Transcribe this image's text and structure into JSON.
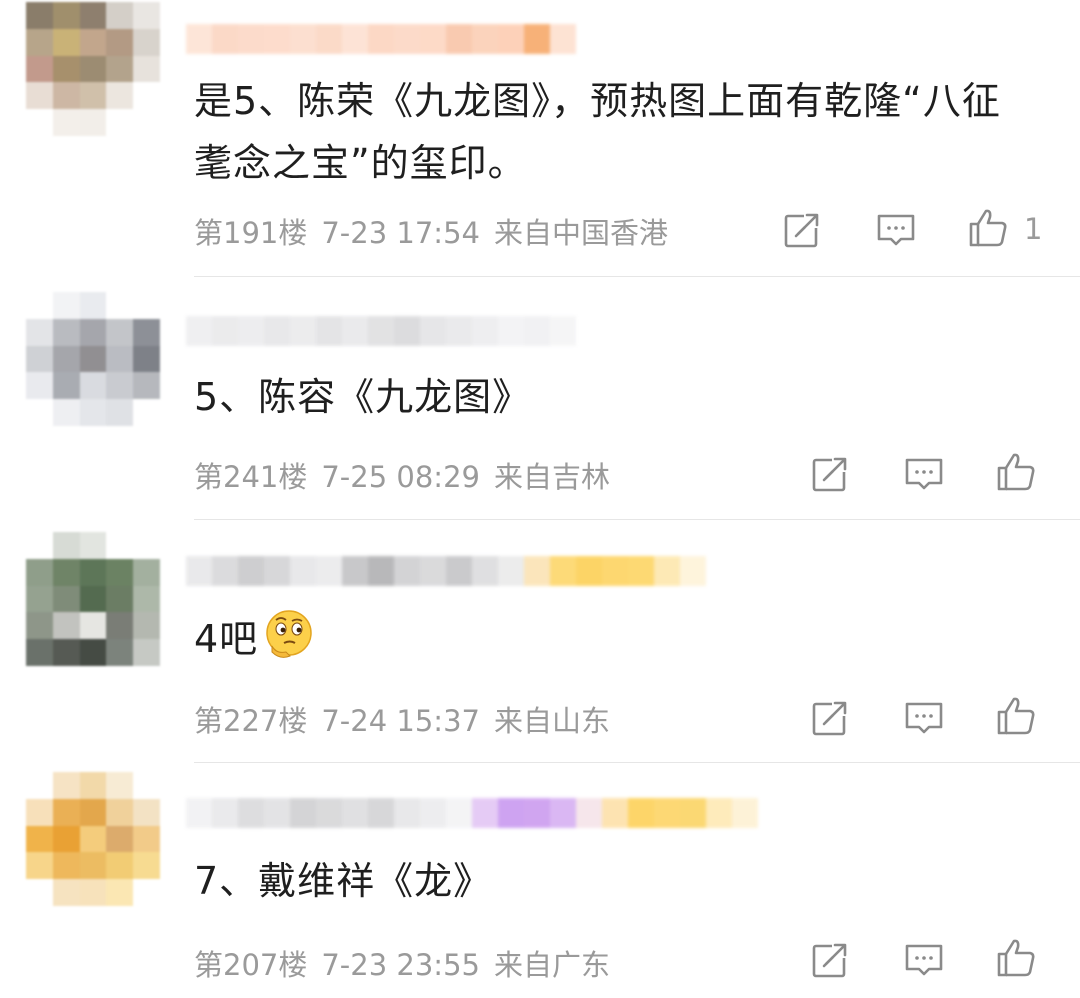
{
  "comments": [
    {
      "text": "是5、陈荣《九龙图》，预热图上面有乾隆“八征耄念之宝”的玺印。",
      "floor": "第191楼",
      "date": "7-23 17:54",
      "location": "来自中国香港",
      "like_count": "1",
      "avatar_colors": [
        "#8a7d6a",
        "#a08f6c",
        "#8e7f6e",
        "#d4cfc8",
        "#e9e6e2",
        "#b7a58a",
        "#c9b277",
        "#c2a68c",
        "#b39a84",
        "#d8d3cc",
        "#c29a8c",
        "#a7906c",
        "#9c8c72",
        "#b3a38c",
        "#e7e2dc",
        "#e8ddd4",
        "#cdb7a4",
        "#d0c0aa",
        "#ece6df",
        "#ffffff",
        "#ffffff",
        "#f3efea",
        "#f2eee9",
        "#ffffff",
        "#ffffff"
      ],
      "username_colors": [
        "#fde3d4",
        "#fbd5c2",
        "#fcd8c6",
        "#fdd9c7",
        "#fcdccb",
        "#fbd7c3",
        "#fde1d2",
        "#fcd4bf",
        "#fcd7c4",
        "#fdd6c2",
        "#f9c5a8",
        "#fbcfb5",
        "#fdcdb2",
        "#f7a96a",
        "#fde0cf"
      ]
    },
    {
      "text": "5、陈容《九龙图》",
      "floor": "第241楼",
      "date": "7-25 08:29",
      "location": "来自吉林",
      "like_count": "",
      "avatar_colors": [
        "#ffffff",
        "#f2f3f5",
        "#e9ebef",
        "#ffffff",
        "#ffffff",
        "#e3e4e7",
        "#b9bbc0",
        "#a5a6ac",
        "#c3c5c9",
        "#8d9097",
        "#cfd1d5",
        "#a5a6ab",
        "#918f92",
        "#babcc2",
        "#7e8188",
        "#e9eaee",
        "#a9acb2",
        "#d9dbe0",
        "#c9cbd0",
        "#b6b8bd",
        "#ffffff",
        "#eeeff2",
        "#e4e6ea",
        "#dfe1e5",
        "#ffffff"
      ],
      "username_colors": [
        "#eeeef0",
        "#e9e9eb",
        "#ececee",
        "#e6e6e8",
        "#eaeaec",
        "#e2e2e4",
        "#e8e8ea",
        "#dfdfe1",
        "#d9d9db",
        "#e4e4e6",
        "#e8e8ea",
        "#ededef",
        "#f2f2f4",
        "#f0f0f2",
        "#f5f5f6",
        "#ffffff"
      ]
    },
    {
      "text": "4吧",
      "floor": "第227楼",
      "date": "7-24 15:37",
      "location": "来自山东",
      "like_count": "",
      "avatar_colors": [
        "#ffffff",
        "#d7dbd5",
        "#e2e5e0",
        "#ffffff",
        "#ffffff",
        "#8f9e8a",
        "#6f8467",
        "#5d7658",
        "#6b8263",
        "#a3b09f",
        "#95a290",
        "#7f8c79",
        "#546b50",
        "#6b7d64",
        "#adb8a9",
        "#8e9689",
        "#c2c3bf",
        "#e6e6e2",
        "#7a7d76",
        "#b4b8b0",
        "#6a716a",
        "#565a54",
        "#454b44",
        "#7c837c",
        "#c6c9c4"
      ],
      "username_colors": [
        "#e7e7e9",
        "#d8d8da",
        "#c9c9cb",
        "#d3d3d5",
        "#e6e6e8",
        "#eaeaec",
        "#c3c3c5",
        "#b1b1b3",
        "#cfcfd1",
        "#d6d6d8",
        "#c5c5c7",
        "#dcdcde",
        "#eaeaea",
        "#fbe3b4",
        "#fdd66a",
        "#fcd056",
        "#fdd361",
        "#fdd564",
        "#fde7ad",
        "#fef3d9"
      ]
    },
    {
      "text": "7、戴维祥《龙》",
      "floor": "第207楼",
      "date": "7-23 23:55",
      "location": "来自广东",
      "like_count": "",
      "avatar_colors": [
        "#ffffff",
        "#f6e3c4",
        "#f2d9a9",
        "#f7ebd4",
        "#ffffff",
        "#f7e0ba",
        "#eab055",
        "#e3a74c",
        "#f0d19b",
        "#f3e2c4",
        "#f0b34a",
        "#e9a134",
        "#f4cc7c",
        "#dcab6c",
        "#f2cb89",
        "#f7d58a",
        "#eeb85c",
        "#ecbc62",
        "#f2cc74",
        "#f7db91",
        "#ffffff",
        "#f6e3c0",
        "#f7e2bb",
        "#fbe7b3",
        "#ffffff"
      ],
      "username_colors": [
        "#f1f1f3",
        "#e8e8ea",
        "#dadadc",
        "#e1e1e3",
        "#d0d0d2",
        "#d6d6d8",
        "#dddddf",
        "#d3d3d5",
        "#e6e6e8",
        "#ececee",
        "#f3f3f5",
        "#e3c6f4",
        "#c99af0",
        "#cc9cef",
        "#d6b0f2",
        "#f6e4e9",
        "#fde1a9",
        "#fdd159",
        "#fdd465",
        "#fbd464",
        "#fee9b4",
        "#fdf1d3"
      ]
    }
  ],
  "icons": {
    "repost": "share-edit-icon",
    "reply": "comment-bubble-icon",
    "like": "thumbs-up-icon"
  },
  "colors": {
    "meta_text": "#9a9a9a",
    "body_text": "#1f1f1f",
    "divider": "#e6e6e6",
    "icon_stroke": "#8a8a8a"
  }
}
